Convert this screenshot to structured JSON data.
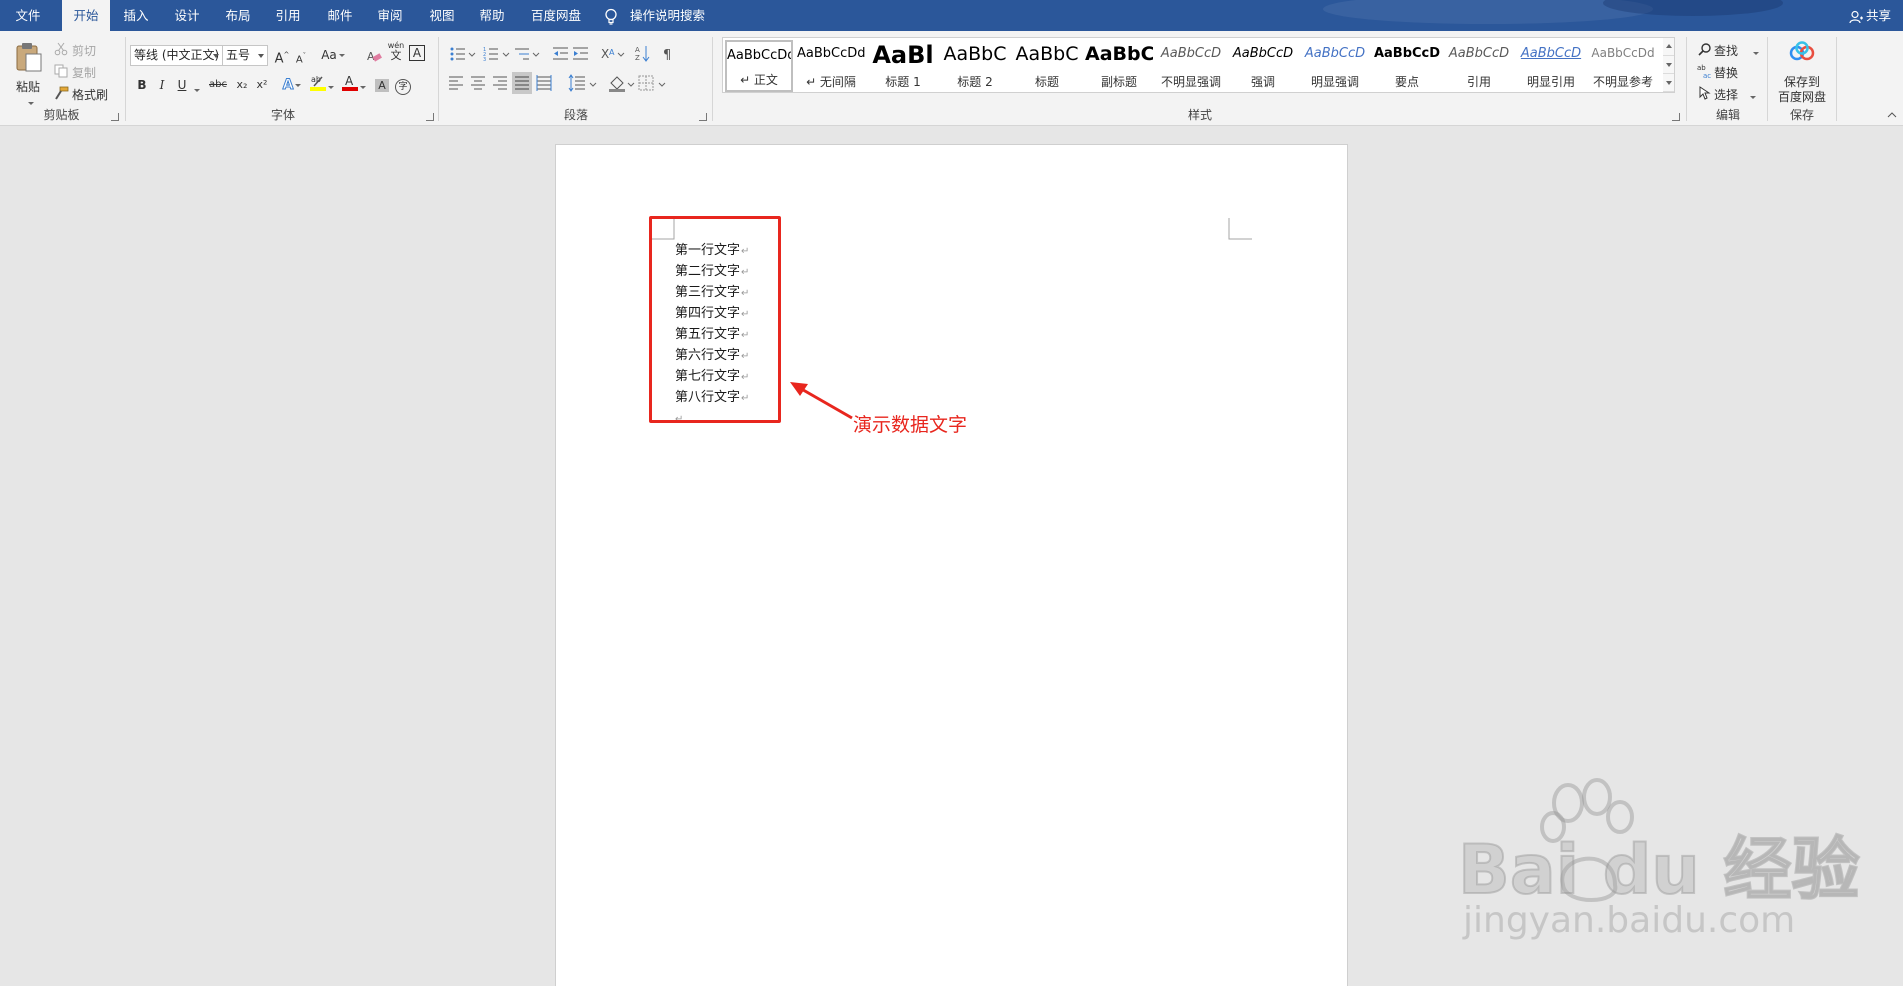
{
  "tabs": [
    {
      "label": "文件"
    },
    {
      "label": "开始"
    },
    {
      "label": "插入"
    },
    {
      "label": "设计"
    },
    {
      "label": "布局"
    },
    {
      "label": "引用"
    },
    {
      "label": "邮件"
    },
    {
      "label": "审阅"
    },
    {
      "label": "视图"
    },
    {
      "label": "帮助"
    },
    {
      "label": "百度网盘"
    }
  ],
  "active_tab": "开始",
  "tell_me": "操作说明搜索",
  "share": "共享",
  "clipboard": {
    "paste": "粘贴",
    "cut": "剪切",
    "copy": "复制",
    "format_painter": "格式刷",
    "group_label": "剪贴板"
  },
  "font": {
    "font_name": "等线 (中文正文)",
    "font_size": "五号",
    "group_label": "字体",
    "case_label": "Aa",
    "bold": "B",
    "italic": "I",
    "underline": "U",
    "strike": "abc",
    "subscript": "x₂",
    "superscript": "x²",
    "phonetic": "wén",
    "phonetic_char": "文",
    "border_char": "A",
    "enclose_char": "字"
  },
  "paragraph": {
    "group_label": "段落"
  },
  "styles": {
    "group_label": "样式",
    "items": [
      {
        "preview": "AaBbCcDd",
        "name": "↵ 正文"
      },
      {
        "preview": "AaBbCcDd",
        "name": "↵ 无间隔"
      },
      {
        "preview": "AaBl",
        "name": "标题 1"
      },
      {
        "preview": "AaBbC",
        "name": "标题 2"
      },
      {
        "preview": "AaBbC",
        "name": "标题"
      },
      {
        "preview": "AaBbC",
        "name": "副标题"
      },
      {
        "preview": "AaBbCcD",
        "name": "不明显强调"
      },
      {
        "preview": "AaBbCcD",
        "name": "强调"
      },
      {
        "preview": "AaBbCcD",
        "name": "明显强调"
      },
      {
        "preview": "AaBbCcD",
        "name": "要点"
      },
      {
        "preview": "AaBbCcD",
        "name": "引用"
      },
      {
        "preview": "AaBbCcD",
        "name": "明显引用"
      },
      {
        "preview": "AaBbCcDd",
        "name": "不明显参考"
      }
    ]
  },
  "editing": {
    "find": "查找",
    "replace": "替换",
    "select": "选择",
    "group_label": "编辑"
  },
  "save": {
    "button_line1": "保存到",
    "button_line2": "百度网盘",
    "group_label": "保存"
  },
  "document": {
    "lines": [
      "第一行文字",
      "第二行文字",
      "第三行文字",
      "第四行文字",
      "第五行文字",
      "第六行文字",
      "第七行文字",
      "第八行文字"
    ],
    "paragraph_mark": "↵"
  },
  "annotation": "演示数据文字",
  "watermark": {
    "brand": "Bai du 经验",
    "url": "jingyan.baidu.com"
  },
  "colors": {
    "title_bar": "#2b579a",
    "annotation_red": "#e8261e",
    "ribbon_bg": "#f3f3f3",
    "workspace_bg": "#e6e6e6"
  }
}
